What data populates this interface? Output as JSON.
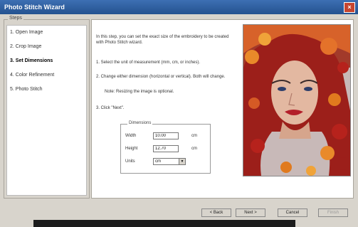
{
  "window": {
    "title": "Photo Stitch Wizard"
  },
  "steps": {
    "legend": "Steps",
    "items": [
      {
        "label": "1. Open Image"
      },
      {
        "label": "2. Crop Image"
      },
      {
        "label": "3. Set Dimensions"
      },
      {
        "label": "4. Color Refinement"
      },
      {
        "label": "5. Photo Stitch"
      }
    ]
  },
  "main": {
    "intro": "In this step, you can set the exact size of the embroidery to be created with Photo Stitch wizard.",
    "step1": "1.  Select the unit of measurement (mm, cm, or inches).",
    "step2": "2.  Change either dimension (horizontal or vertical). Both will change.",
    "note": "Note: Resizing the image is optional.",
    "step3": "3.  Click \"Next\".",
    "dimensions": {
      "legend": "Dimensions",
      "width_label": "Width",
      "width_value": "10.00",
      "width_unit": "cm",
      "height_label": "Height",
      "height_value": "12.70",
      "height_unit": "cm",
      "units_label": "Units",
      "units_value": "cm"
    }
  },
  "buttons": {
    "back": "< Back",
    "next": "Next >",
    "cancel": "Cancel",
    "finish": "Finish"
  },
  "colors": {
    "title_bar": "#2f5fa2",
    "dialog_bg": "#d8d4cc",
    "portrait_bg": "#c5b8b8",
    "leaves_red": "#b6221c",
    "leaves_orange": "#e07a1e"
  },
  "icons": {
    "close": "close-icon",
    "dropdown": "chevron-down-icon"
  }
}
